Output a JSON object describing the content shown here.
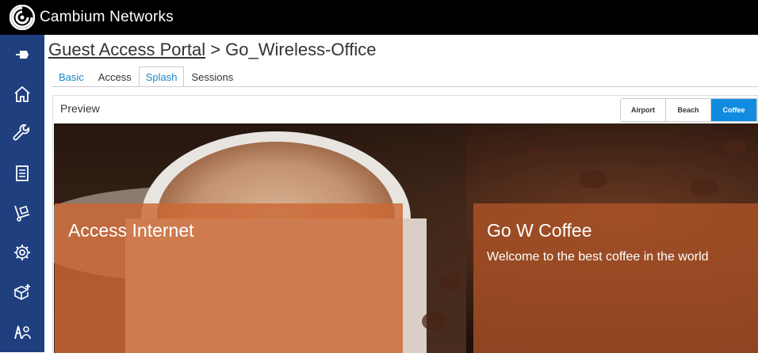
{
  "header": {
    "brand_name": "Cambium Networks",
    "icon": "cambium-logo-icon",
    "bg_color": "#000000"
  },
  "sidebar": {
    "bg_color": "#1f3f7f",
    "items": [
      {
        "name": "pin",
        "icon": "pin-icon"
      },
      {
        "name": "home",
        "icon": "home-icon"
      },
      {
        "name": "tools",
        "icon": "wrench-icon"
      },
      {
        "name": "reports",
        "icon": "document-list-icon"
      },
      {
        "name": "inventory",
        "icon": "hand-truck-icon"
      },
      {
        "name": "settings",
        "icon": "gear-icon"
      },
      {
        "name": "onboard",
        "icon": "box-plus-icon"
      },
      {
        "name": "users",
        "icon": "user-access-icon"
      }
    ]
  },
  "breadcrumb": {
    "root": "Guest Access Portal",
    "separator": " > ",
    "current": "Go_Wireless-Office"
  },
  "tabs": [
    {
      "label": "Basic",
      "active": false
    },
    {
      "label": "Access",
      "active": false
    },
    {
      "label": "Splash",
      "active": true
    },
    {
      "label": "Sessions",
      "active": false
    }
  ],
  "preview": {
    "title": "Preview",
    "themes": [
      {
        "label": "Airport",
        "active": false
      },
      {
        "label": "Beach",
        "active": false
      },
      {
        "label": "Coffee",
        "active": true
      }
    ],
    "accent_color": "#0f8be0",
    "login_card": {
      "title": "Access Internet"
    },
    "info_card": {
      "title": "Go W Coffee",
      "subtitle": "Welcome to the best coffee in the world"
    }
  }
}
